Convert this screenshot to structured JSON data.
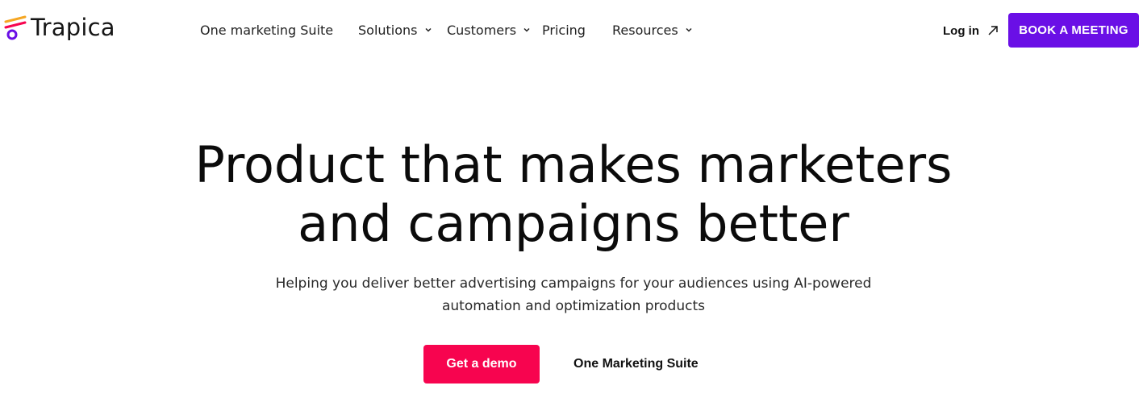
{
  "brand": {
    "name": "Trapica",
    "colors": {
      "stripe_orange": "#f5a623",
      "stripe_pink": "#f7044f",
      "ring_purple": "#6a0fe6"
    }
  },
  "nav": {
    "items": [
      {
        "label": "One marketing Suite",
        "has_dropdown": false
      },
      {
        "label": "Solutions",
        "has_dropdown": true
      },
      {
        "label": "Customers",
        "has_dropdown": true
      },
      {
        "label": "Pricing",
        "has_dropdown": false
      },
      {
        "label": "Resources",
        "has_dropdown": true
      }
    ],
    "login_label": "Log in",
    "cta_label": "BOOK A MEETING",
    "cta_color": "#6a0fe6"
  },
  "hero": {
    "title_lines": [
      "Product that makes marketers",
      "and campaigns better"
    ],
    "subtitle_lines": [
      "Helping you deliver better advertising campaigns for your audiences using AI-powered",
      "automation and optimization products"
    ],
    "primary_cta": "Get a demo",
    "primary_cta_color": "#f7044f",
    "secondary_cta": "One Marketing Suite"
  },
  "icons": {
    "logo": "trapica-logo-icon",
    "dropdown": "chevron-down-icon",
    "external": "arrow-up-right-icon"
  }
}
